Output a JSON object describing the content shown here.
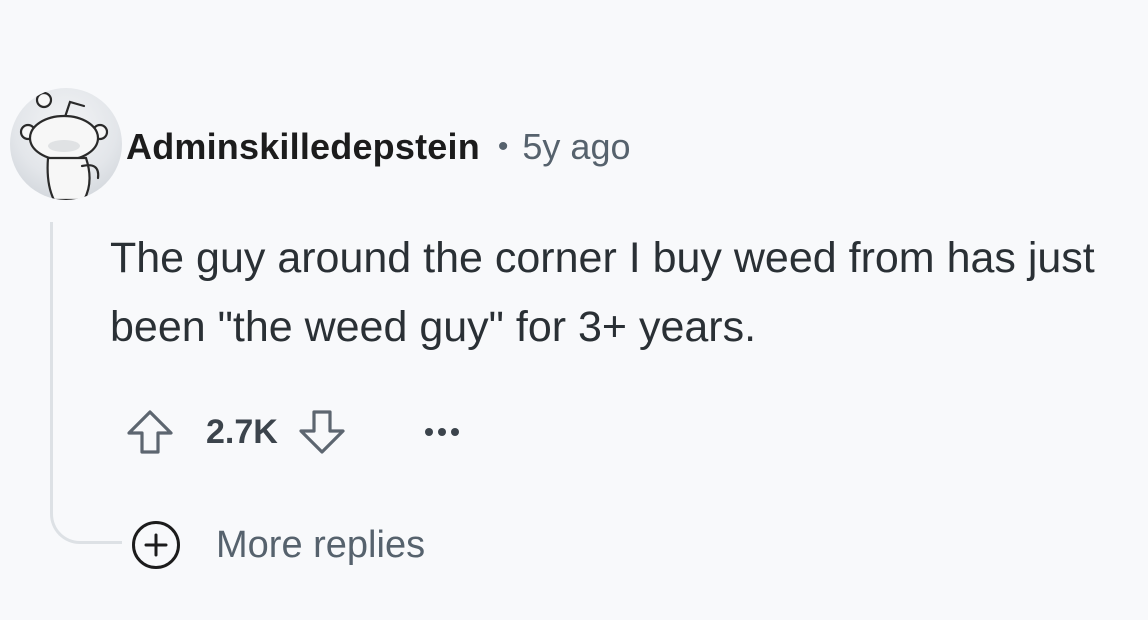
{
  "comment": {
    "author": "Adminskilledepstein",
    "separator": "•",
    "time_ago": "5y ago",
    "body": "The guy around the corner I buy weed from has just been \"the weed guy\" for 3+ years.",
    "score": "2.7K"
  },
  "icons": {
    "avatar": "snoo-avatar-icon",
    "upvote": "upvote-arrow-icon",
    "downvote": "downvote-arrow-icon",
    "overflow": "ellipsis-icon",
    "expand": "plus-circle-icon"
  },
  "more_replies": {
    "label": "More replies"
  },
  "colors": {
    "background": "#f8f9fb",
    "author": "#1c1c1c",
    "meta": "#56626d",
    "body": "#2a3035",
    "thread_line": "#dde1e5"
  }
}
